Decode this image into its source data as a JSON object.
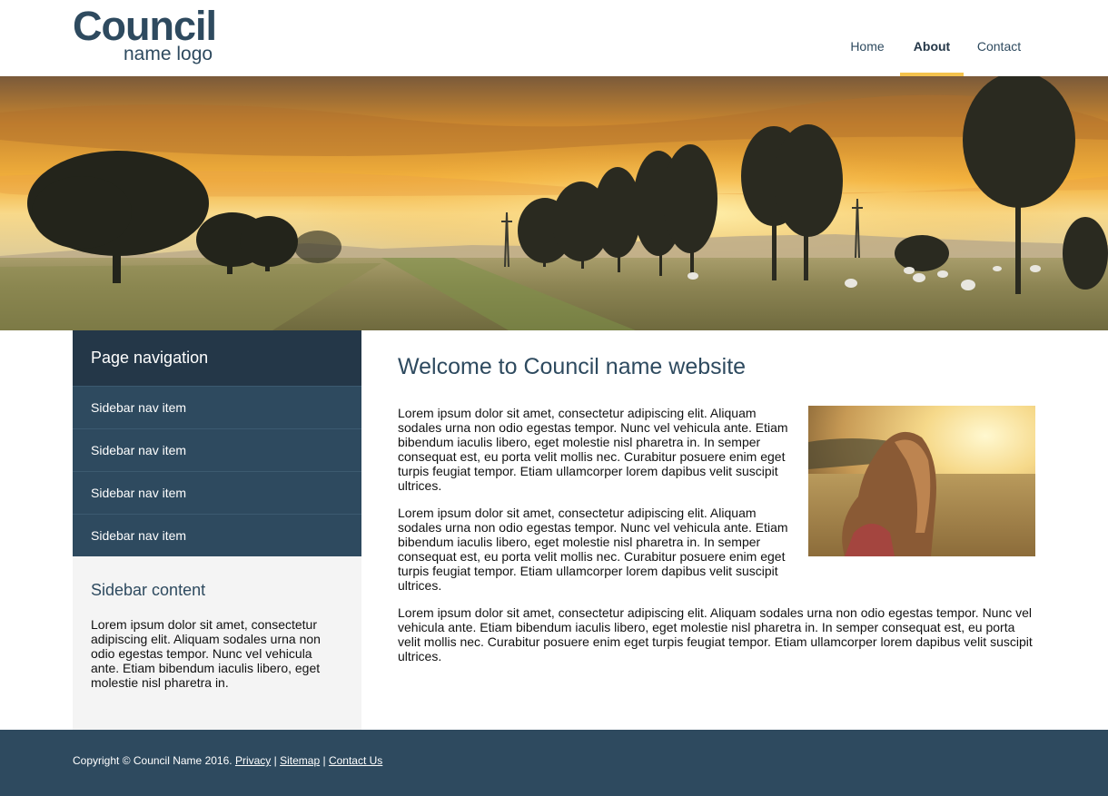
{
  "logo": {
    "main": "Council",
    "sub": "name logo"
  },
  "nav": {
    "items": [
      {
        "label": "Home"
      },
      {
        "label": "About",
        "active": true
      },
      {
        "label": "Contact"
      }
    ]
  },
  "sidebar": {
    "heading": "Page navigation",
    "items": [
      {
        "label": "Sidebar nav item"
      },
      {
        "label": "Sidebar nav item"
      },
      {
        "label": "Sidebar nav item"
      },
      {
        "label": "Sidebar nav item"
      }
    ],
    "content_title": "Sidebar content",
    "content_text": "Lorem ipsum dolor sit amet, consectetur adipiscing elit. Aliquam sodales urna non odio egestas tempor. Nunc vel vehicula ante. Etiam bibendum iaculis libero, eget molestie nisl pharetra in."
  },
  "main": {
    "title": "Welcome to Council name website",
    "paragraphs": [
      "Lorem ipsum dolor sit amet, consectetur adipiscing elit. Aliquam sodales urna non odio egestas tempor. Nunc vel vehicula ante. Etiam bibendum iaculis libero, eget molestie nisl pharetra in. In semper consequat est, eu porta velit mollis nec. Curabitur posuere enim eget turpis feugiat tempor. Etiam ullamcorper lorem dapibus velit suscipit ultrices.",
      "Lorem ipsum dolor sit amet, consectetur adipiscing elit. Aliquam sodales urna non odio egestas tempor. Nunc vel vehicula ante. Etiam bibendum iaculis libero, eget molestie nisl pharetra in. In semper consequat est, eu porta velit mollis nec. Curabitur posuere enim eget turpis feugiat tempor. Etiam ullamcorper lorem dapibus velit suscipit ultrices.",
      "Lorem ipsum dolor sit amet, consectetur adipiscing elit. Aliquam sodales urna non odio egestas tempor. Nunc vel vehicula ante. Etiam bibendum iaculis libero, eget molestie nisl pharetra in. In semper consequat est, eu porta velit mollis nec. Curabitur posuere enim eget turpis feugiat tempor. Etiam ullamcorper lorem dapibus velit suscipit ultrices."
    ]
  },
  "footer": {
    "copyright": "Copyright © Council Name 2016.",
    "sep": "|",
    "links": [
      {
        "label": "Privacy"
      },
      {
        "label": "Sitemap"
      },
      {
        "label": "Contact Us"
      }
    ]
  },
  "colors": {
    "brand": "#2e4a5f",
    "brand_dark": "#243748",
    "accent": "#f4c24c"
  }
}
